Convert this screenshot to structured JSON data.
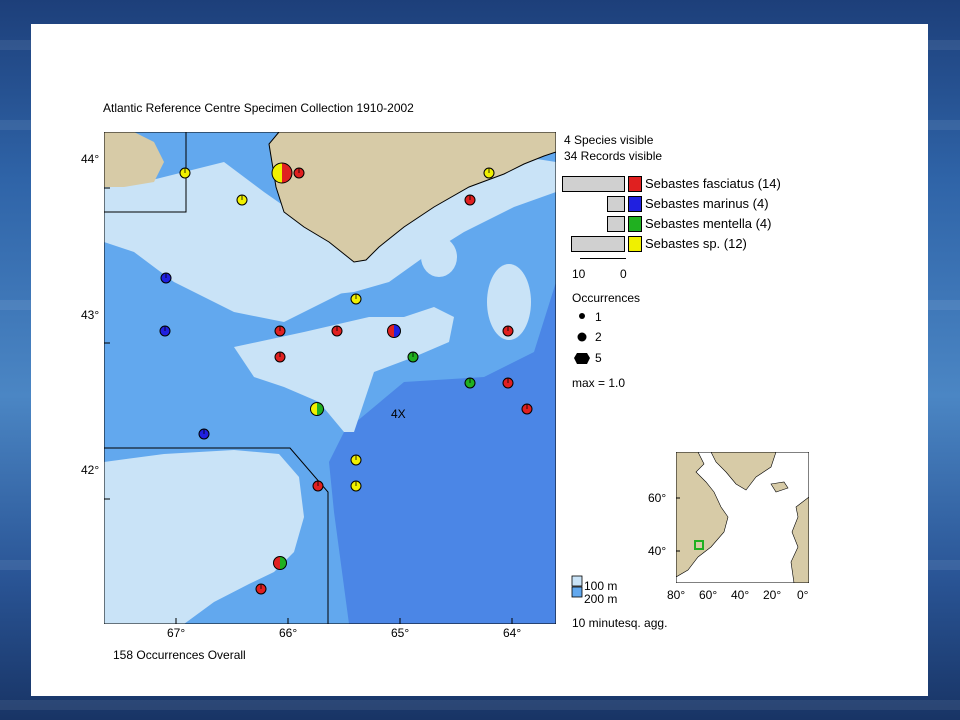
{
  "title": "Atlantic Reference Centre Specimen Collection 1910-2002",
  "summary": {
    "species_visible": "4 Species visible",
    "records_visible": "34 Records visible",
    "overall": "158 Occurrences Overall"
  },
  "legend": {
    "species": [
      {
        "label": "Sebastes fasciatus (14)",
        "color": "#e02020",
        "count": 14
      },
      {
        "label": "Sebastes marinus (4)",
        "color": "#2020e0",
        "count": 4
      },
      {
        "label": "Sebastes mentella (4)",
        "color": "#20b020",
        "count": 4
      },
      {
        "label": "Sebastes sp. (12)",
        "color": "#f0f000",
        "count": 12
      }
    ],
    "bar_axis_labels": [
      "10",
      "0"
    ],
    "occurrences_title": "Occurrences",
    "occurrence_sizes": [
      "1",
      "2",
      "5"
    ],
    "max_label": "max = 1.0",
    "depth_labels": [
      "100 m",
      "200 m"
    ],
    "depth_colors": [
      "#c9e3f7",
      "#62a8ee"
    ],
    "aggregation": "10 minutesq. agg."
  },
  "map": {
    "lat_labels": [
      "44°",
      "43°",
      "42°"
    ],
    "lon_labels": [
      "67°",
      "66°",
      "65°",
      "64°"
    ],
    "zone_label": "4X",
    "colors": {
      "land": "#d7cba7",
      "shallow": "#c9e3f7",
      "mid": "#62a8ee",
      "deep": "#4b86e6"
    }
  },
  "inset": {
    "lat_labels": [
      "60°",
      "40°"
    ],
    "lon_labels": [
      "80°",
      "60°",
      "40°",
      "20°",
      "0°"
    ]
  }
}
